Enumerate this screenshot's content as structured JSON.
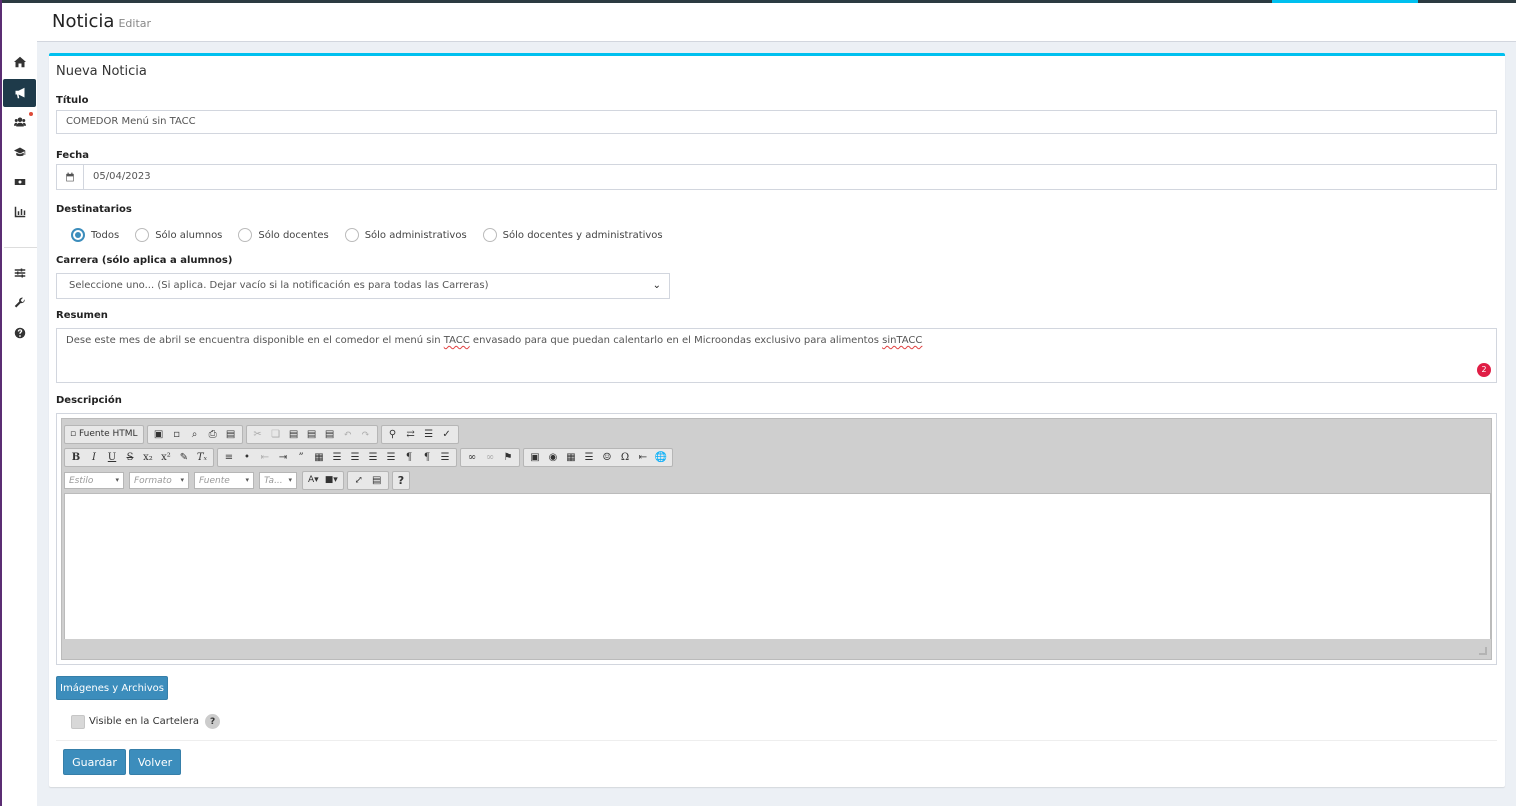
{
  "header": {
    "title": "Noticia",
    "subtitle": "Editar"
  },
  "sidebar": {
    "icons": [
      "home-icon",
      "bullhorn-icon",
      "users-icon",
      "graduation-cap-icon",
      "money-icon",
      "bar-chart-icon",
      "sliders-icon",
      "wrench-icon",
      "question-icon"
    ]
  },
  "form": {
    "box_title": "Nueva Noticia",
    "titulo_label": "Título",
    "titulo_value": "COMEDOR Menú sin TACC",
    "fecha_label": "Fecha",
    "fecha_value": "05/04/2023",
    "destinatarios_label": "Destinatarios",
    "destinatarios": [
      {
        "label": "Todos",
        "selected": true
      },
      {
        "label": "Sólo alumnos",
        "selected": false
      },
      {
        "label": "Sólo docentes",
        "selected": false
      },
      {
        "label": "Sólo administrativos",
        "selected": false
      },
      {
        "label": "Sólo docentes y administrativos",
        "selected": false
      }
    ],
    "carrera_label": "Carrera (sólo aplica a alumnos)",
    "carrera_value": "Seleccione uno... (Si aplica. Dejar vacío si la notificación es para todas las Carreras)",
    "resumen_label": "Resumen",
    "resumen_parts": [
      "Dese este mes de abril se encuentra disponible en el comedor el menú sin ",
      "TACC",
      " envasado para que puedan calentarlo en el Microondas exclusivo para alimentos ",
      "sinTACC"
    ],
    "resumen_badge": "2",
    "descripcion_label": "Descripción",
    "editor": {
      "source_label": "Fuente HTML",
      "combo_estilo": "Estilo",
      "combo_formato": "Formato",
      "combo_fuente": "Fuente",
      "combo_tamano": "Ta...",
      "help": "?"
    },
    "archivos_button": "Imágenes y Archivos",
    "visible_label": "Visible en la Cartelera",
    "visible_checked": false,
    "help_mark": "?",
    "guardar_button": "Guardar",
    "volver_button": "Volver"
  },
  "colors": {
    "accent": "#3c8dbc",
    "box_top": "#00c0ef",
    "sidebar_active": "#1e3a4a"
  }
}
